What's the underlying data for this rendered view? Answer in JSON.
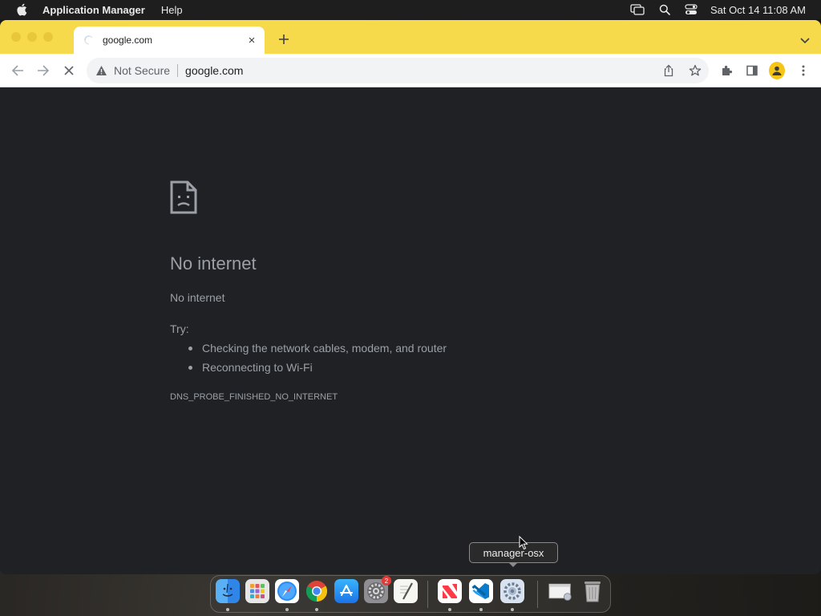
{
  "menubar": {
    "app_name": "Application Manager",
    "menu_help": "Help",
    "clock": "Sat Oct 14  11:08 AM",
    "icons": [
      "apple-icon",
      "screen-mirroring-icon",
      "spotlight-search-icon",
      "control-center-icon"
    ]
  },
  "browser": {
    "tab": {
      "title": "google.com",
      "icon": "loading-spinner-icon"
    },
    "new_tab_label": "+",
    "close_tab_label": "×",
    "omnibox": {
      "security_label": "Not Secure",
      "url": "google.com"
    },
    "colors": {
      "tabstrip": "#f7d94c",
      "content_bg": "#202124",
      "avatar": "#f5c518"
    }
  },
  "error_page": {
    "title": "No internet",
    "subtitle": "No internet",
    "try_label": "Try:",
    "suggestions": [
      "Checking the network cables, modem, and router",
      "Reconnecting to Wi-Fi"
    ],
    "error_code": "DNS_PROBE_FINISHED_NO_INTERNET"
  },
  "dock": {
    "tooltip": "manager-osx",
    "items": [
      {
        "name": "Finder",
        "icon": "finder-icon",
        "running": true
      },
      {
        "name": "Launchpad",
        "icon": "launchpad-icon",
        "running": false
      },
      {
        "name": "Safari",
        "icon": "safari-icon",
        "running": true
      },
      {
        "name": "Google Chrome",
        "icon": "chrome-icon",
        "running": true
      },
      {
        "name": "App Store",
        "icon": "app-store-icon",
        "running": false
      },
      {
        "name": "System Settings",
        "icon": "system-settings-icon",
        "running": false,
        "badge": "2"
      },
      {
        "name": "TextEdit",
        "icon": "textedit-icon",
        "running": false
      },
      {
        "name": "News",
        "icon": "news-icon",
        "running": true
      },
      {
        "name": "Visual Studio Code",
        "icon": "vscode-icon",
        "running": true
      },
      {
        "name": "manager-osx",
        "icon": "manager-osx-icon",
        "running": true
      },
      {
        "name": "Downloads",
        "icon": "downloads-stack-icon",
        "running": false
      },
      {
        "name": "Trash",
        "icon": "trash-icon",
        "running": false
      }
    ]
  }
}
